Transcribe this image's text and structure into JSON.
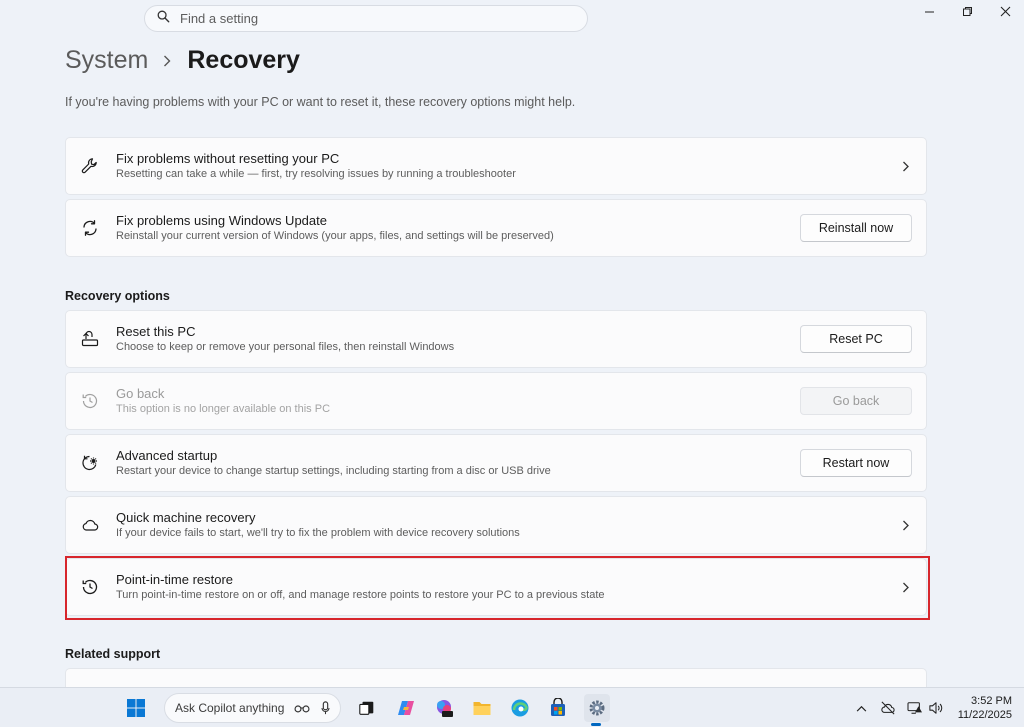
{
  "search": {
    "placeholder": "Find a setting"
  },
  "breadcrumb": {
    "parent": "System",
    "current": "Recovery"
  },
  "subtitle": "If you're having problems with your PC or want to reset it, these recovery options might help.",
  "top_cards": [
    {
      "title": "Fix problems without resetting your PC",
      "desc": "Resetting can take a while — first, try resolving issues by running a troubleshooter"
    },
    {
      "title": "Fix problems using Windows Update",
      "desc": "Reinstall your current version of Windows (your apps, files, and settings will be preserved)",
      "button": "Reinstall now"
    }
  ],
  "recovery_options": {
    "heading": "Recovery options",
    "items": [
      {
        "title": "Reset this PC",
        "desc": "Choose to keep or remove your personal files, then reinstall Windows",
        "button": "Reset PC"
      },
      {
        "title": "Go back",
        "desc": "This option is no longer available on this PC",
        "button": "Go back",
        "disabled": true
      },
      {
        "title": "Advanced startup",
        "desc": "Restart your device to change startup settings, including starting from a disc or USB drive",
        "button": "Restart now"
      },
      {
        "title": "Quick machine recovery",
        "desc": "If your device fails to start, we'll try to fix the problem with device recovery solutions"
      },
      {
        "title": "Point-in-time restore",
        "desc": "Turn point-in-time restore on or off, and manage restore points to restore your PC to a previous state"
      }
    ]
  },
  "related_support": {
    "heading": "Related support"
  },
  "taskbar": {
    "copilot_placeholder": "Ask Copilot anything",
    "time": "3:52 PM",
    "date": "11/22/2025"
  },
  "colors": {
    "highlight": "#d7262c",
    "accent": "#0067c0"
  }
}
